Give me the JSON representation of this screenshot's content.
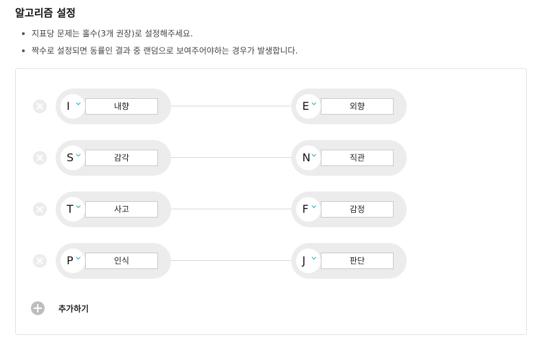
{
  "title": "알고리즘 설정",
  "notes": [
    "지표당 문제는 홀수(3개 권장)로 설정해주세요.",
    "짝수로 설정되면 동률인 결과 중 랜덤으로 보여주어야하는 경우가 발생합니다."
  ],
  "pairs": [
    {
      "left": {
        "letter": "I",
        "label": "내향"
      },
      "right": {
        "letter": "E",
        "label": "외향"
      }
    },
    {
      "left": {
        "letter": "S",
        "label": "감각"
      },
      "right": {
        "letter": "N",
        "label": "직관"
      }
    },
    {
      "left": {
        "letter": "T",
        "label": "사고"
      },
      "right": {
        "letter": "F",
        "label": "감정"
      }
    },
    {
      "left": {
        "letter": "P",
        "label": "인식"
      },
      "right": {
        "letter": "J",
        "label": "판단"
      }
    }
  ],
  "add_label": "추가하기",
  "icons": {
    "remove": "close-circle-icon",
    "dropdown": "chevron-down-icon",
    "add": "plus-circle-icon"
  },
  "colors": {
    "chevron": "#2bb5c4",
    "pill": "#ececec",
    "remove": "#ececec",
    "add": "#bdbdbd"
  }
}
